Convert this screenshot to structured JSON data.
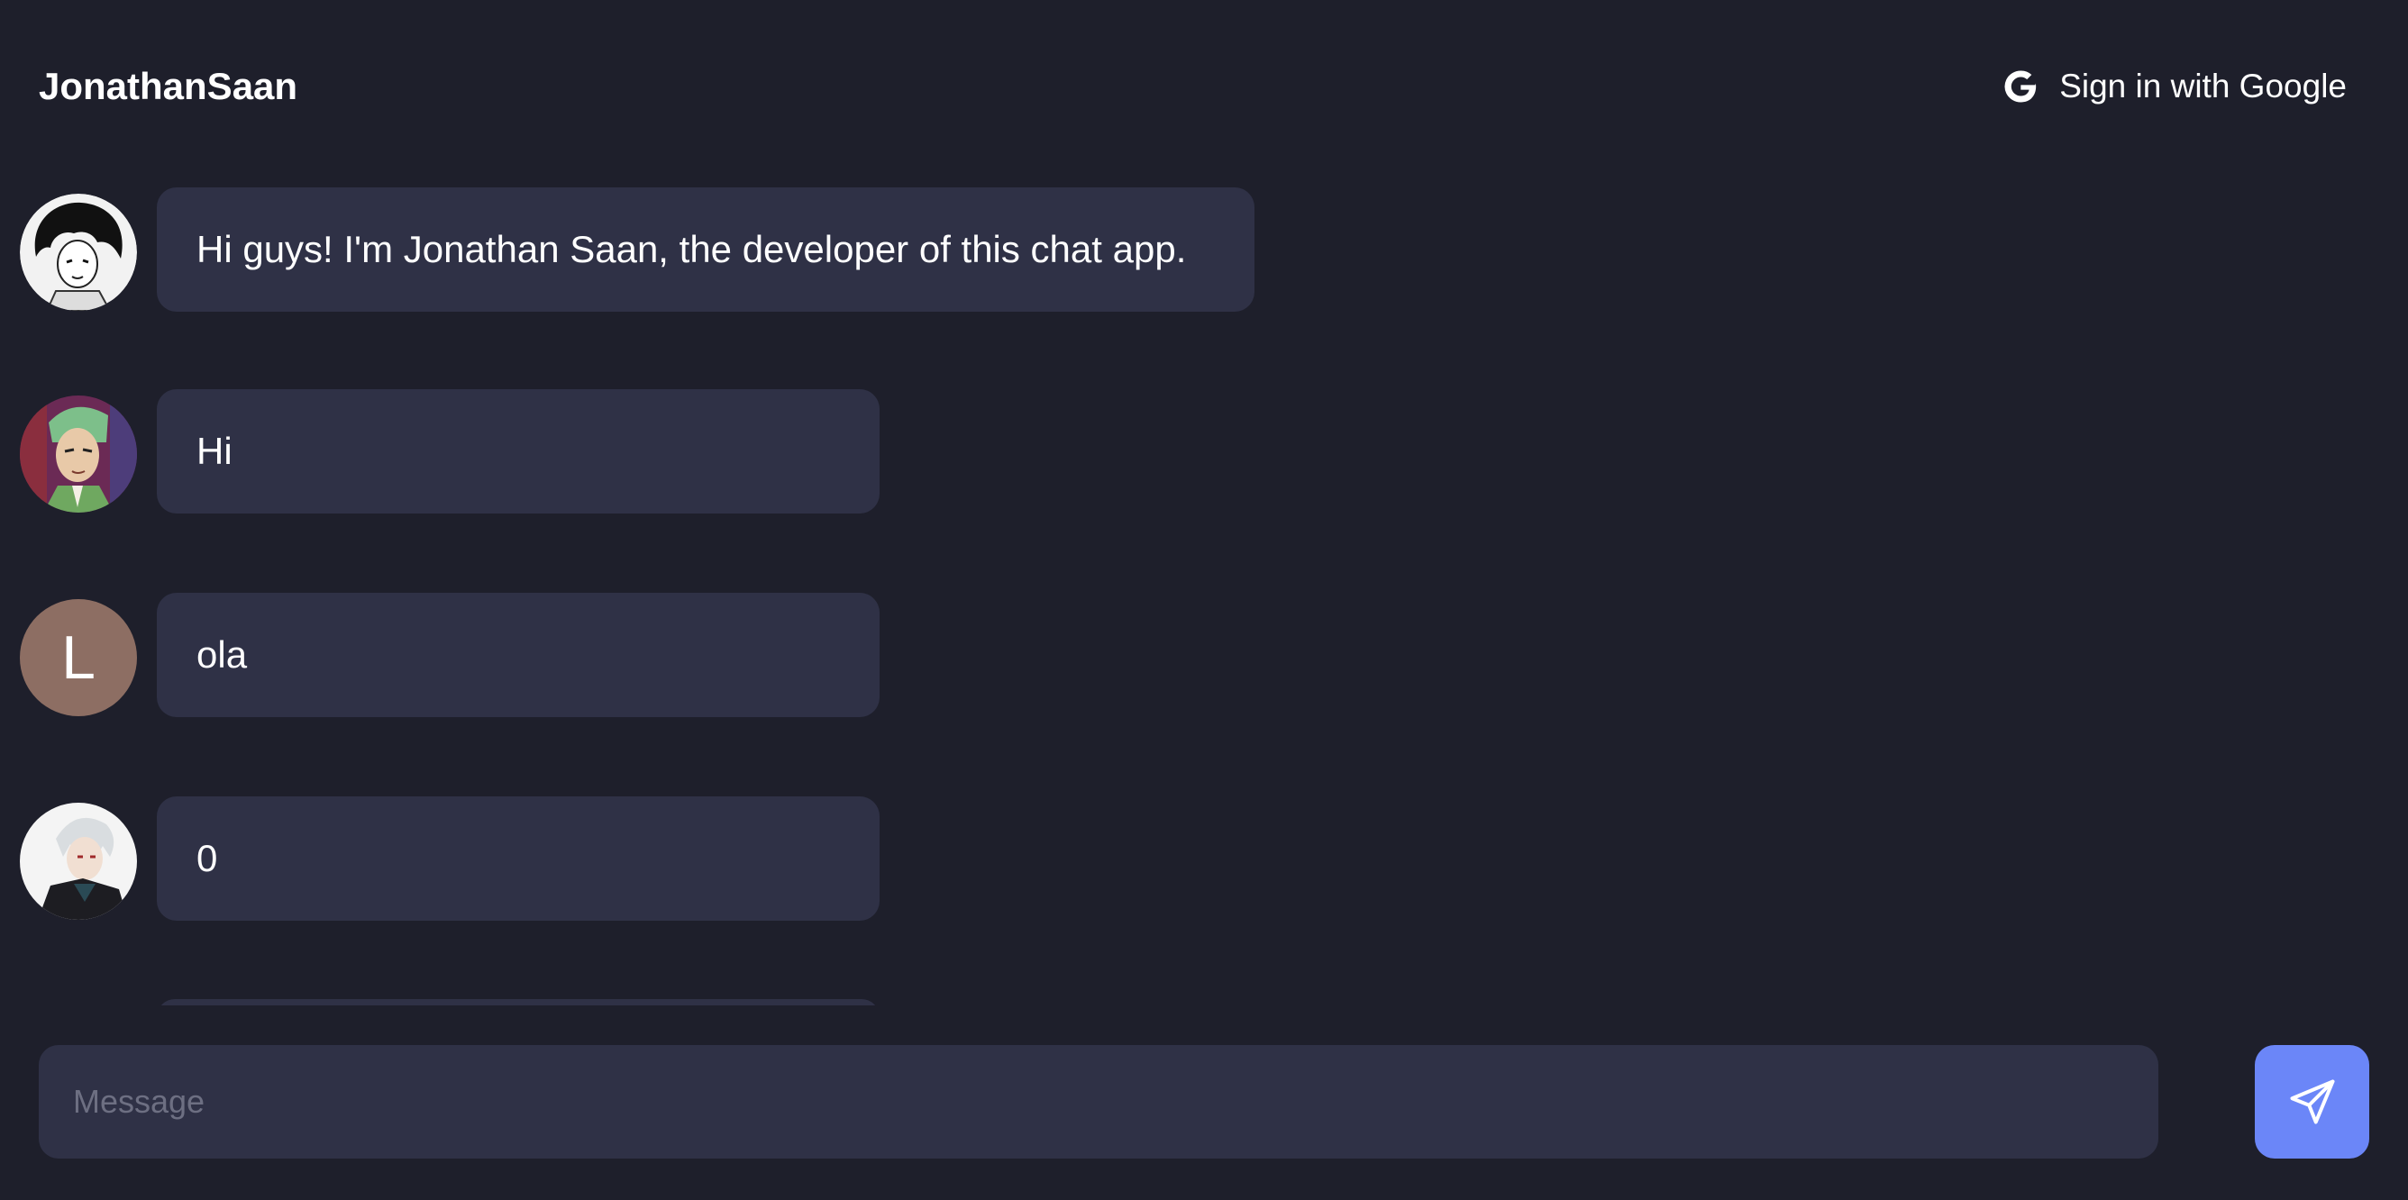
{
  "header": {
    "title": "JonathanSaan",
    "signin_label": "Sign in with Google",
    "signin_icon": "google-icon"
  },
  "messages": [
    {
      "avatar": "portrait-avatar",
      "text": "Hi guys! I'm Jonathan Saan, the developer of this chat app."
    },
    {
      "avatar": "portrait-avatar",
      "text": "Hi"
    },
    {
      "avatar": "letter-avatar",
      "avatar_letter": "L",
      "avatar_color": "#8d6e63",
      "text": "ola"
    },
    {
      "avatar": "portrait-avatar",
      "text": "0"
    }
  ],
  "composer": {
    "placeholder": "Message",
    "value": "",
    "send_icon": "send-icon"
  },
  "colors": {
    "background": "#1e1f2b",
    "bubble": "#2f3146",
    "accent": "#6b86f8"
  }
}
